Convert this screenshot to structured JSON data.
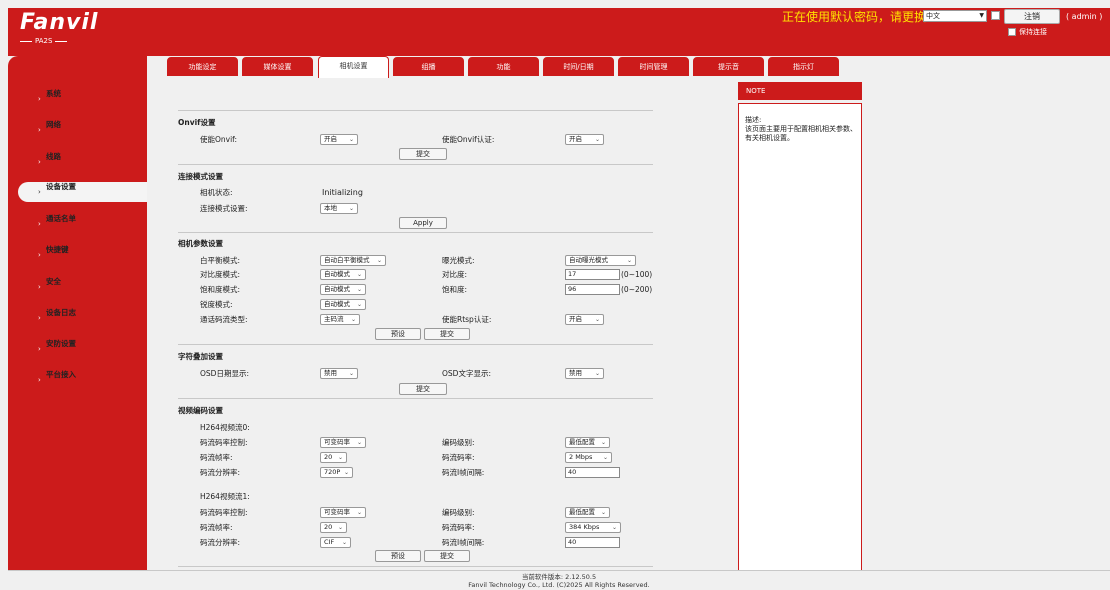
{
  "header": {
    "logo": "Fanvil",
    "model": "PA2S",
    "warning": "正在使用默认密码，请更换",
    "language": "中文",
    "logout_label": "注销",
    "user": "( admin )",
    "keep_connected_label": "保持连接"
  },
  "tabs": [
    {
      "label": "功能设定",
      "active": false
    },
    {
      "label": "媒体设置",
      "active": false
    },
    {
      "label": "相机设置",
      "active": true
    },
    {
      "label": "组播",
      "active": false
    },
    {
      "label": "功能",
      "active": false
    },
    {
      "label": "时间/日期",
      "active": false
    },
    {
      "label": "时间管理",
      "active": false
    },
    {
      "label": "提示音",
      "active": false
    },
    {
      "label": "指示灯",
      "active": false
    }
  ],
  "sidebar": {
    "items": [
      {
        "label": "系统",
        "active": false
      },
      {
        "label": "网络",
        "active": false
      },
      {
        "label": "线路",
        "active": false
      },
      {
        "label": "设备设置",
        "active": true
      },
      {
        "label": "通话名单",
        "active": false
      },
      {
        "label": "快捷键",
        "active": false
      },
      {
        "label": "安全",
        "active": false
      },
      {
        "label": "设备日志",
        "active": false
      },
      {
        "label": "安防设置",
        "active": false
      },
      {
        "label": "平台接入",
        "active": false
      }
    ]
  },
  "onvif": {
    "title": "Onvif设置",
    "enable_label": "使能Onvif:",
    "enable_value": "开启",
    "auth_label": "使能Onvif认证:",
    "auth_value": "开启",
    "submit": "提交"
  },
  "connection": {
    "title": "连接模式设置",
    "status_label": "相机状态:",
    "status_value": "Initializing",
    "mode_label": "连接模式设置:",
    "mode_value": "本地",
    "apply": "Apply"
  },
  "camera_params": {
    "title": "相机参数设置",
    "wb_label": "白平衡模式:",
    "wb_value": "自动白平衡模式",
    "exposure_label": "曝光模式:",
    "exposure_value": "自动曝光模式",
    "contrast_mode_label": "对比度模式:",
    "contrast_mode_value": "自动模式",
    "contrast_label": "对比度:",
    "contrast_value": "17",
    "contrast_range": "(0~100)",
    "saturation_mode_label": "饱和度模式:",
    "saturation_mode_value": "自动模式",
    "saturation_label": "饱和度:",
    "saturation_value": "96",
    "saturation_range": "(0~200)",
    "sharpness_mode_label": "锐度模式:",
    "sharpness_mode_value": "自动模式",
    "stream_type_label": "通话码流类型:",
    "stream_type_value": "主码流",
    "rtsp_auth_label": "使能Rtsp认证:",
    "rtsp_auth_value": "开启",
    "preset": "预设",
    "submit": "提交"
  },
  "osd": {
    "title": "字符叠加设置",
    "date_label": "OSD日期显示:",
    "date_value": "禁用",
    "text_label": "OSD文字显示:",
    "text_value": "禁用",
    "submit": "提交"
  },
  "video": {
    "title": "视频编码设置",
    "stream0": {
      "name": "H264视频流0:",
      "rate_ctrl_label": "码流码率控制:",
      "rate_ctrl_value": "可变码率",
      "level_label": "编码级别:",
      "level_value": "最低配置",
      "fps_label": "码流帧率:",
      "fps_value": "20",
      "bitrate_label": "码流码率:",
      "bitrate_value": "2 Mbps",
      "resolution_label": "码流分辨率:",
      "resolution_value": "720P",
      "iframe_label": "码流I帧间隔:",
      "iframe_value": "40"
    },
    "stream1": {
      "name": "H264视频流1:",
      "rate_ctrl_label": "码流码率控制:",
      "rate_ctrl_value": "可变码率",
      "level_label": "编码级别:",
      "level_value": "最低配置",
      "fps_label": "码流帧率:",
      "fps_value": "20",
      "bitrate_label": "码流码率:",
      "bitrate_value": "384 Kbps",
      "resolution_label": "码流分辨率:",
      "resolution_value": "CIF",
      "iframe_label": "码流I帧间隔:",
      "iframe_value": "40"
    },
    "preset": "预设",
    "submit": "提交"
  },
  "note": {
    "header": "NOTE",
    "title": "描述:",
    "text": "该页面主要用于配置相机相关参数、有关相机设置。"
  },
  "footer": {
    "version": "当前软件版本: 2.12.50.5",
    "copyright": "Fanvil Technology Co., Ltd. (C)2025 All Rights Reserved."
  },
  "colors": {
    "brand": "#cc1b1b",
    "warning": "#ffe000"
  }
}
